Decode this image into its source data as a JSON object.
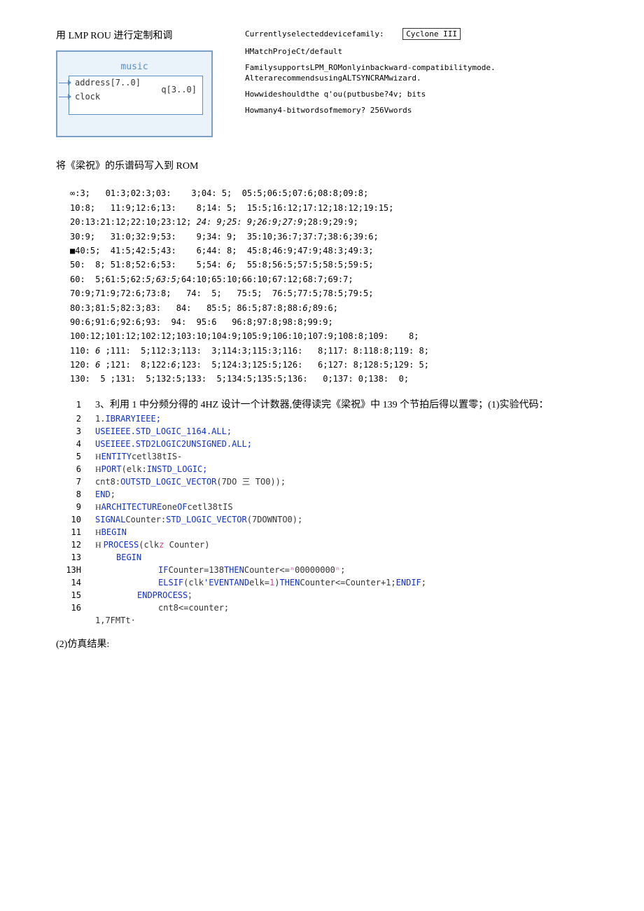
{
  "header": {
    "lmp_title": "用 LMP ROU 进行定制和调",
    "right": {
      "curfam": "Currentlyselecteddevicefamily:",
      "famval": "Cyclone III",
      "match": "HMatchProjeCt/default",
      "famsup": "FamilysupportsLPM_ROMonlyinbackward-compatibilitymode.",
      "altrec": "AlterarecommendsusingALTSYNCRAMwizard.",
      "howwide": "Howwideshouldthe q'ou(putbusbe?4v; bits",
      "howmany": "Howmany4-bitwordsofmemory?     256Vwords"
    }
  },
  "diagram": {
    "title": "music",
    "port_addr": "address[7..0]",
    "port_clock": "clock",
    "port_q": "q[3..0]"
  },
  "rom_heading": "将《梁祝》的乐谱码写入到 ROM",
  "mem": {
    "l1": "∞:3;   01:3;02:3;03:    3;04: 5;  05:5;06:5;07:6;08:8;09:8;",
    "l2": "10:8;   11:9;12:6;13:    8;14: 5;  15:5;16:12;17:12;18:12;19:15;",
    "l3_a": "20:13:21:12;22:10;23:12; ",
    "l3_b": "24: 9;25: 9;26:9;27:9",
    "l3_c": ";28:9;29:9;",
    "l4": "30:9;   31:0;32:9;53:    9;34: 9;  35:10;36:7;37:7;38:6;39:6;",
    "l5": "■40:5;  41:5;42:5;43:    6;44: 8;  45:8;46:9;47:9;48:3;49:3;",
    "l6_a": "50:  8; 51:8;52:6;53:    5;54: ",
    "l6_b": "6;",
    "l6_c": "  55:8;56:5;57:5;58:5;59:5;",
    "l7_a": "60:  5;61:5;62:",
    "l7_b": "5;63:5;",
    "l7_c": "64:10;65:10;66:10;67:12;68:7;69:7;",
    "l8_a": "70:9;71:9;72:6;73:8;   74:  5;   75:5;  76:5;77:5;78:5;79:5;",
    "l9_a": "80:3;81:5;82:3;83:   84:   85:5; 86:5;87:8;88:",
    "l9_b": "6;",
    "l9_c": "89:6;",
    "l10": "90:6;91:6;92:6;93:  94:  95:6   96:8;97:8;98:8;99:9;",
    "l11": "100:12;101:12;102:12;103:10;104:9;105:9;106:10;107:9;108:8;109:    8;",
    "l12_a": "110: ",
    "l12_b": "6",
    "l12_c": " ;111:  5;112:3;113:  3;114:3;115:3;116:   8;117: 8:118:8;119: 8;",
    "l13_a": "120: ",
    "l13_b": "6",
    "l13_c": " ;121:  8;122:",
    "l13_d": "6",
    "l13_e": ";123:  5;124:3;125:5;126:   6;127: 8;128:5;129: 5;",
    "l14": "130:  5 ;131:  5;132:5;133:  5;134:5;135:5;136:   0;137: 0;138:  0;"
  },
  "task3": "3、利用 1 中分频分得的 4HZ 设计一个计数器,使得读完《梁祝》中 139 个节拍后得以置零；(1)实验代码：",
  "code": {
    "l2": [
      "",
      "1.",
      "IBRARYIEEE;"
    ],
    "l3": [
      "",
      "USE",
      "IEEE.STD_LOGIC_1164.ALL;"
    ],
    "l4": [
      "",
      "USE",
      "IEEE.STD2LOGIC2UNSIGNED.ALL;"
    ],
    "l5": [
      "H",
      "ENTITY",
      "cetl38tIS-"
    ],
    "l6": [
      "H",
      "PORT",
      "(elk:",
      "INSTD_LOGIC;"
    ],
    "l7": [
      "",
      "cnt8:",
      "OUT",
      "STD_LOGIC_VECTOR",
      "(7DO 三 TO0));"
    ],
    "l8": [
      "",
      "END",
      ";"
    ],
    "l9": [
      "H",
      "ARCHITECTURE",
      "one",
      "OF",
      "cetl38tIS"
    ],
    "l10": [
      "",
      "SIGNAL",
      "Counter:",
      "STD_LOGIC_VECTOR",
      "(7DOWNTO0);"
    ],
    "l11": [
      "H",
      "BEGIN",
      ""
    ],
    "l12": [
      "H ",
      "PROCESS",
      "(clk",
      "z",
      "            Counter)"
    ],
    "l13": [
      "",
      "BEGIN",
      ""
    ],
    "l13H": [
      "",
      "IF",
      "Counter=138",
      "THEN",
      "Counter<=",
      "ⁿ",
      "00000000",
      "ⁿ",
      ";"
    ],
    "l14": [
      "",
      "ELSIF",
      "(clk",
      "'EVENT",
      "AND",
      "elk=",
      "1",
      ")",
      "THEN",
      "Counter<=Counter+1;",
      "ENDIF",
      ";"
    ],
    "l15": [
      "",
      "ENDPROCESS",
      "；"
    ],
    "l16": [
      "",
      "cnt8<=counter;"
    ],
    "l17": [
      "1,7FMTt·"
    ]
  },
  "sim_label": "(2)仿真结果:"
}
